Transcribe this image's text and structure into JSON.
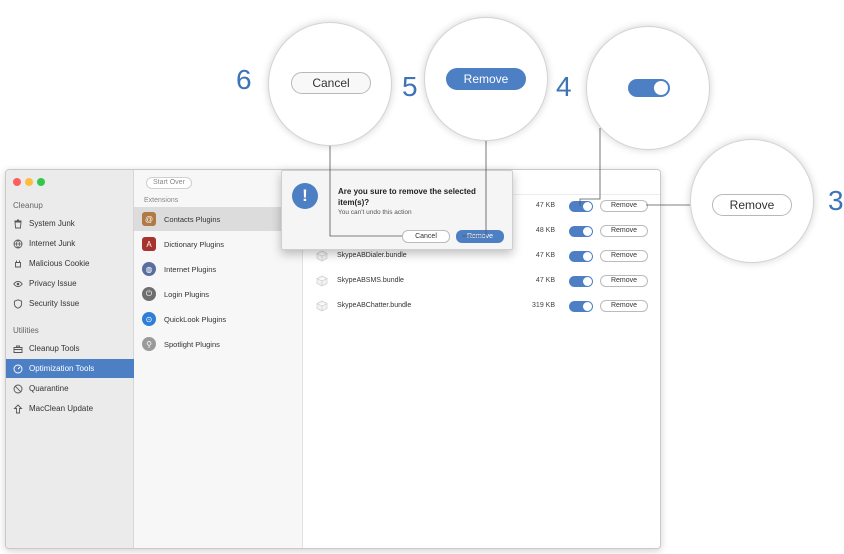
{
  "callouts": {
    "n6": "6",
    "n5": "5",
    "n4": "4",
    "n3": "3",
    "cancel_zoom": "Cancel",
    "remove_zoom_blue": "Remove",
    "remove_zoom_white": "Remove"
  },
  "sidebar": {
    "cleanup_label": "Cleanup",
    "cleanup_items": [
      {
        "label": "System Junk",
        "icon": "trash-icon"
      },
      {
        "label": "Internet Junk",
        "icon": "globe-icon"
      },
      {
        "label": "Malicious Cookie",
        "icon": "cookie-icon"
      },
      {
        "label": "Privacy Issue",
        "icon": "eye-icon"
      },
      {
        "label": "Security Issue",
        "icon": "shield-icon"
      }
    ],
    "utilities_label": "Utilities",
    "utility_items": [
      {
        "label": "Cleanup Tools",
        "icon": "toolbox-icon"
      },
      {
        "label": "Optimization Tools",
        "icon": "speedometer-icon"
      },
      {
        "label": "Quarantine",
        "icon": "quarantine-icon"
      },
      {
        "label": "MacClean Update",
        "icon": "update-icon"
      }
    ]
  },
  "middle": {
    "start_over": "Start Over",
    "extensions_label": "Extensions",
    "plugins": [
      {
        "label": "Contacts Plugins"
      },
      {
        "label": "Dictionary Plugins"
      },
      {
        "label": "Internet Plugins"
      },
      {
        "label": "Login Plugins"
      },
      {
        "label": "QuickLook Plugins"
      },
      {
        "label": "Spotlight Plugins"
      }
    ]
  },
  "rows": [
    {
      "name": "",
      "size": "47 KB",
      "remove": "Remove"
    },
    {
      "name": "",
      "size": "48 KB",
      "remove": "Remove"
    },
    {
      "name": "SkypeABDialer.bundle",
      "size": "47 KB",
      "remove": "Remove"
    },
    {
      "name": "SkypeABSMS.bundle",
      "size": "47 KB",
      "remove": "Remove"
    },
    {
      "name": "SkypeABChatter.bundle",
      "size": "319 KB",
      "remove": "Remove"
    }
  ],
  "dialog": {
    "alert_glyph": "!",
    "title": "Are you sure to remove the selected item(s)?",
    "subtitle": "You can't undo this action",
    "cancel": "Cancel",
    "remove": "Remove"
  },
  "colors": {
    "accent": "#4d7fc5",
    "callout_number": "#3e73b7"
  }
}
